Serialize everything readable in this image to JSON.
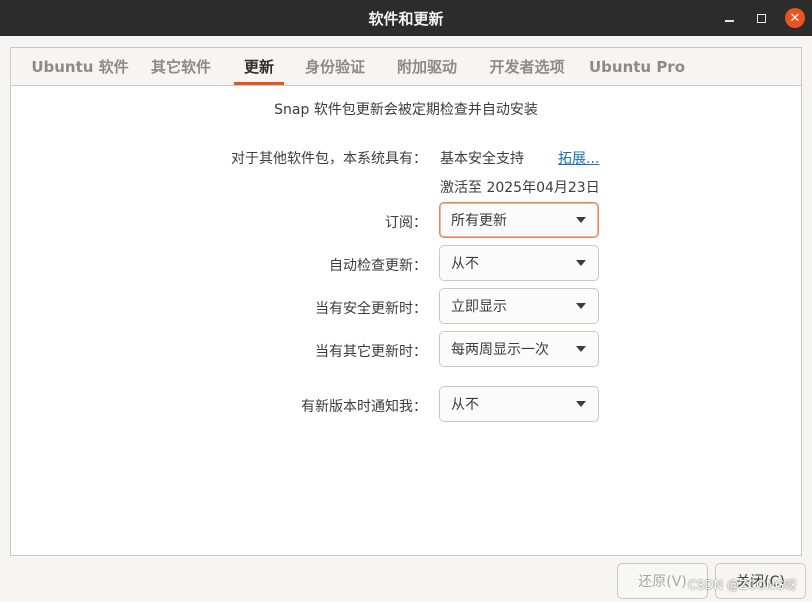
{
  "window": {
    "title": "软件和更新",
    "minimize_icon": "minimize-icon",
    "maximize_icon": "maximize-icon",
    "close_icon": "close-icon",
    "close_glyph": "✕",
    "accent_color": "#e95420"
  },
  "tabs": [
    {
      "label": "Ubuntu 软件",
      "active": false
    },
    {
      "label": "其它软件",
      "active": false
    },
    {
      "label": "更新",
      "active": true
    },
    {
      "label": "身份验证",
      "active": false
    },
    {
      "label": "附加驱动",
      "active": false
    },
    {
      "label": "开发者选项",
      "active": false
    },
    {
      "label": "Ubuntu Pro",
      "active": false
    }
  ],
  "updates": {
    "snap_note": "Snap 软件包更新会被定期检查并自动安装",
    "other_packages_label": "对于其他软件包，本系统具有：",
    "support_value": "基本安全支持",
    "extend_link": "拓展...",
    "activated_until": "激活至 2025年04月23日",
    "subscription": {
      "label": "订阅：",
      "value": "所有更新"
    },
    "auto_check": {
      "label": "自动检查更新：",
      "value": "从不"
    },
    "security_updates": {
      "label": "当有安全更新时：",
      "value": "立即显示"
    },
    "other_updates": {
      "label": "当有其它更新时：",
      "value": "每两周显示一次"
    },
    "notify_new_version": {
      "label": "有新版本时通知我：",
      "value": "从不"
    }
  },
  "buttons": {
    "revert": "还原(V)",
    "close": "关闭(C)"
  },
  "watermark": "CSDN @ZCONG呀"
}
